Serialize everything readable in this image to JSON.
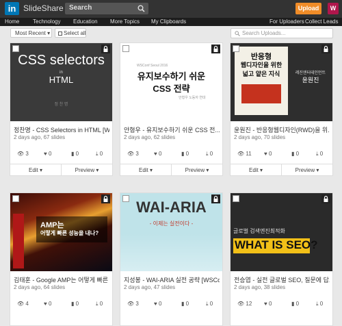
{
  "topbar": {
    "logo_letters": "in",
    "logo_text": "SlideShare",
    "search_placeholder": "Search",
    "upload_label": "Upload",
    "avatar_letter": "W"
  },
  "nav": {
    "left": [
      "Home",
      "Technology",
      "Education",
      "More Topics",
      "My Clipboards"
    ],
    "right": [
      "For Uploaders",
      "Collect Leads"
    ]
  },
  "toolbar": {
    "sort_label": "Most Recent ▾",
    "select_all_label": "Select all",
    "search_placeholder": "Search Uploads..."
  },
  "cards": [
    {
      "title": "정찬명 - CSS Selectors in HTML [WS...",
      "meta": "2 days ago, 67 slides",
      "views": "3",
      "likes": "0",
      "comments": "0",
      "downloads": "0",
      "thumb": {
        "bg": "#3a3a3a",
        "line1": "CSS selectors",
        "line2": "in",
        "line3": "HTML",
        "line4": "정 찬 명"
      }
    },
    {
      "title": "안형우 - 유지보수하기 쉬운 CSS 전...",
      "meta": "2 days ago, 62 slides",
      "views": "3",
      "likes": "0",
      "comments": "0",
      "downloads": "0",
      "thumb": {
        "bg": "#ffffff",
        "line1": "WSConf Seoul 2016",
        "line2": "유지보수하기 쉬운",
        "line3": "CSS 전략",
        "line4": "안형우 노동자 연대"
      }
    },
    {
      "title": "윤원진 - 반응형웹디자인(RWD)을 위...",
      "meta": "2 days ago, 70 slides",
      "views": "11",
      "likes": "0",
      "comments": "0",
      "downloads": "0",
      "thumb": {
        "bg": "#2e2e2e",
        "line1": "반응형",
        "line2": "웹디자인을 위한",
        "line3": "넓고 얕은 지식",
        "line4": "레진엔터테인먼트",
        "line5": "윤원진"
      }
    },
    {
      "title": "김태훈 - Google AMP는 어떻게 빠른 ...",
      "meta": "2 days ago, 64 slides",
      "views": "4",
      "likes": "0",
      "comments": "0",
      "downloads": "0",
      "thumb": {
        "bg": "#1a1010",
        "line1": "AMP는",
        "line2": "어떻게 빠른 성능을 내나?"
      }
    },
    {
      "title": "지성봉 - WAI-ARIA 실전 공략 [WSCo...",
      "meta": "2 days ago, 47 slides",
      "views": "3",
      "likes": "0",
      "comments": "0",
      "downloads": "0",
      "thumb": {
        "bg": "#bfe3e9",
        "line1": "WAI-ARIA",
        "line2": "- 이제는 실전이다 -"
      }
    },
    {
      "title": "전승엽 - 실전 글로벌 SEO, 질문에 답...",
      "meta": "2 days ago, 38 slides",
      "views": "12",
      "likes": "0",
      "comments": "0",
      "downloads": "0",
      "thumb": {
        "bg": "#2a2a2a",
        "line1": "글로벌 검색엔진최적화",
        "line2": "WHAT IS SEO?"
      }
    }
  ],
  "actions": {
    "edit": "Edit ▾",
    "preview": "Preview ▾"
  }
}
